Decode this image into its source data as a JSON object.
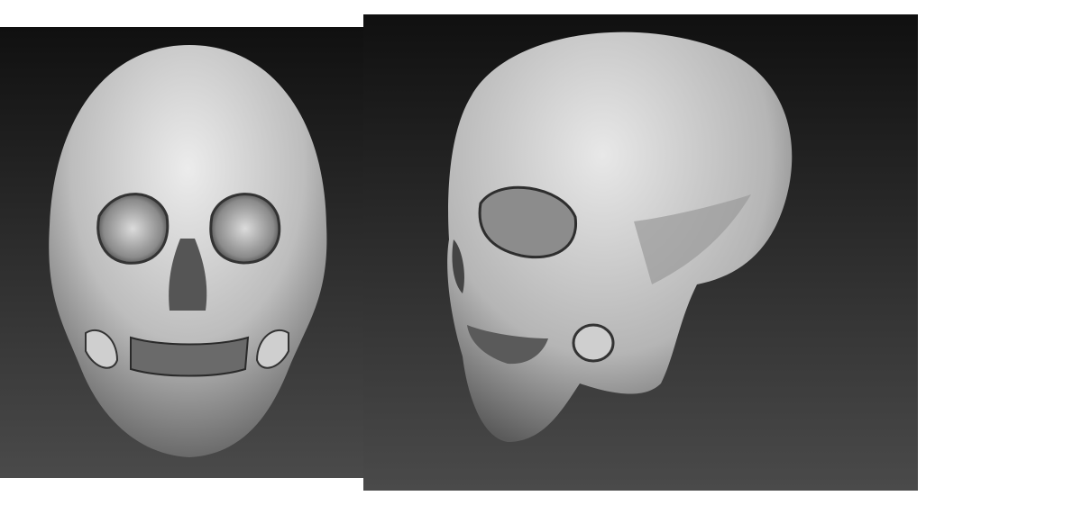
{
  "colors": {
    "page_background": "#ffffff",
    "viewport_top": "#101010",
    "viewport_bottom": "#4a4a4a",
    "skull_light": "#e6e6e6",
    "skull_mid": "#9a9a9a",
    "skull_dark": "#3a3a3a"
  },
  "views": [
    {
      "icon": "skull-front-render"
    },
    {
      "icon": "skull-three-quarter-render"
    }
  ]
}
